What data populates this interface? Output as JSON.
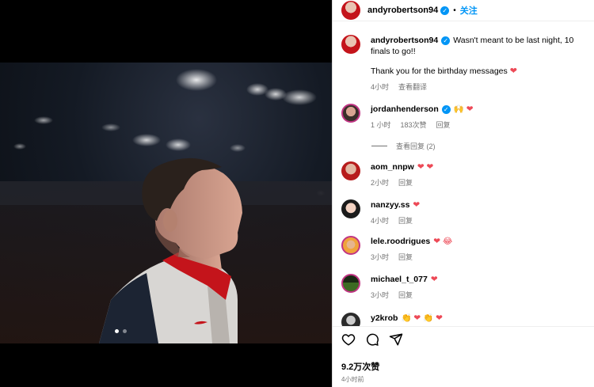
{
  "post": {
    "username": "andyrobertson94",
    "follow_label": "关注",
    "separator": "•"
  },
  "caption": {
    "username": "andyrobertson94",
    "text1": "Wasn't meant to be last night, 10 finals to go!!",
    "text2": "Thank you for the birthday messages",
    "time": "4小时",
    "translate": "查看翻译"
  },
  "comments": [
    {
      "username": "jordanhenderson",
      "text": "🙌 ❤",
      "time": "1 小时",
      "likes": "183次赞",
      "reply": "回复"
    },
    {
      "username": "aom_nnpw",
      "text": "❤ ❤",
      "time": "2小时",
      "reply": "回复"
    },
    {
      "username": "nanzyy.ss",
      "text": "❤",
      "time": "4小时",
      "reply": "回复"
    },
    {
      "username": "lele.roodrigues",
      "text": "❤ 😂",
      "time": "3小时",
      "reply": "回复"
    },
    {
      "username": "michael_t_077",
      "text": "❤",
      "time": "3小时",
      "reply": "回复"
    },
    {
      "username": "y2krob",
      "text": "👏 ❤ 👏 ❤"
    }
  ],
  "view_replies": "查看回复 (2)",
  "footer": {
    "likes": "9.2万次赞",
    "time": "4小时前"
  },
  "icons": {
    "like": "heart-icon",
    "comment": "comment-icon",
    "share": "share-icon"
  },
  "colors": {
    "accent": "#0095f6",
    "heart": "#ed4956",
    "muted": "#737373"
  }
}
